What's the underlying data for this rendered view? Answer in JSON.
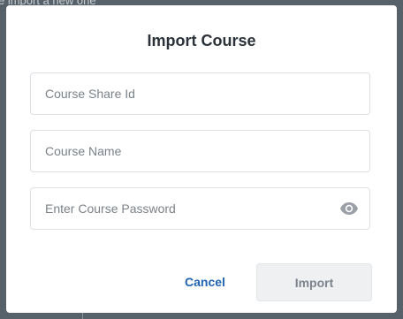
{
  "background": {
    "partial_text": "e import a new one"
  },
  "dialog": {
    "title": "Import Course",
    "fields": {
      "share_id": {
        "value": "",
        "placeholder": "Course Share Id"
      },
      "course_name": {
        "value": "",
        "placeholder": "Course Name"
      },
      "password": {
        "value": "",
        "placeholder": "Enter Course Password",
        "toggle_icon": "eye-icon"
      }
    },
    "buttons": {
      "cancel_label": "Cancel",
      "import_label": "Import",
      "import_state": "disabled"
    }
  },
  "colors": {
    "accent": "#1f63b3",
    "backdrop": "#566169",
    "disabled_button_bg": "#eef0f2",
    "disabled_button_text": "#7d848b"
  }
}
